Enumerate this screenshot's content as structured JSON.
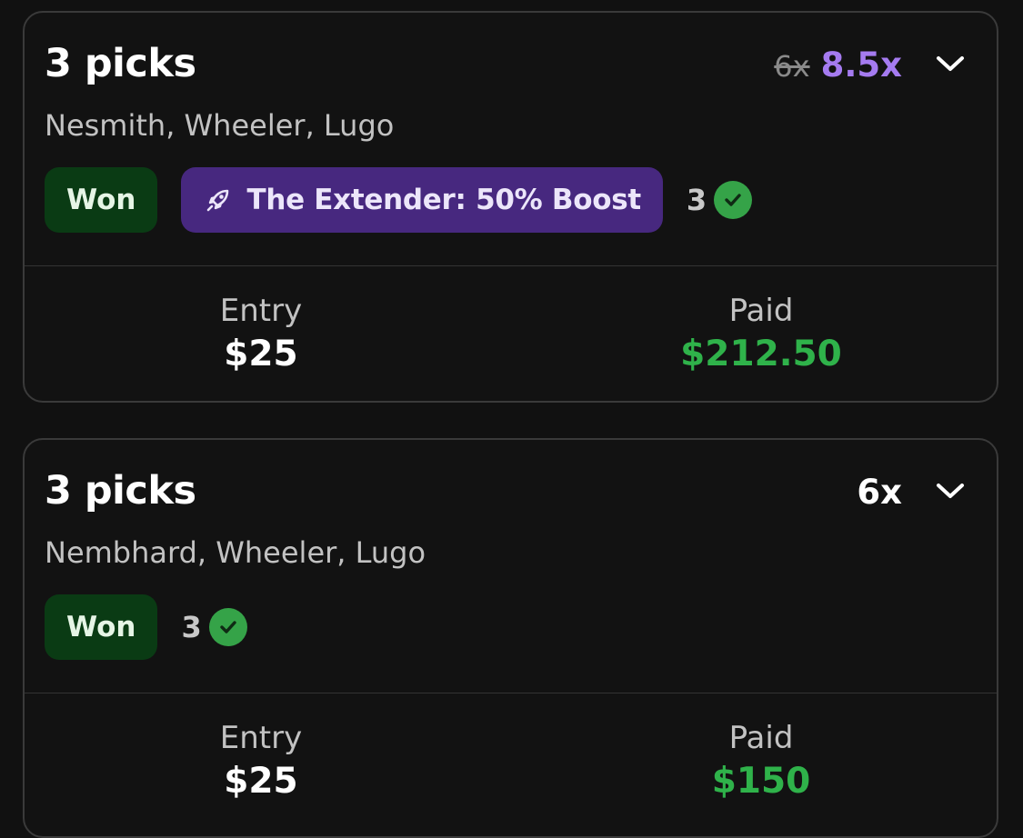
{
  "colors": {
    "background": "#111111",
    "card_border": "#3a3a3a",
    "won_chip_bg": "#0a3b14",
    "boost_chip_bg": "#47287f",
    "boost_multiplier": "#a57bf0",
    "paid_green": "#2fb24a",
    "check_green": "#35a348"
  },
  "entries": [
    {
      "title": "3 picks",
      "players": "Nesmith, Wheeler, Lugo",
      "multiplier_old": "6x",
      "multiplier": "8.5x",
      "status": "Won",
      "boost": {
        "icon": "rocket-icon",
        "label": "The Extender: 50% Boost"
      },
      "correct_count": "3",
      "entry_label": "Entry",
      "entry_value": "$25",
      "paid_label": "Paid",
      "paid_value": "$212.50"
    },
    {
      "title": "3 picks",
      "players": "Nembhard, Wheeler, Lugo",
      "multiplier": "6x",
      "status": "Won",
      "correct_count": "3",
      "entry_label": "Entry",
      "entry_value": "$25",
      "paid_label": "Paid",
      "paid_value": "$150"
    }
  ]
}
